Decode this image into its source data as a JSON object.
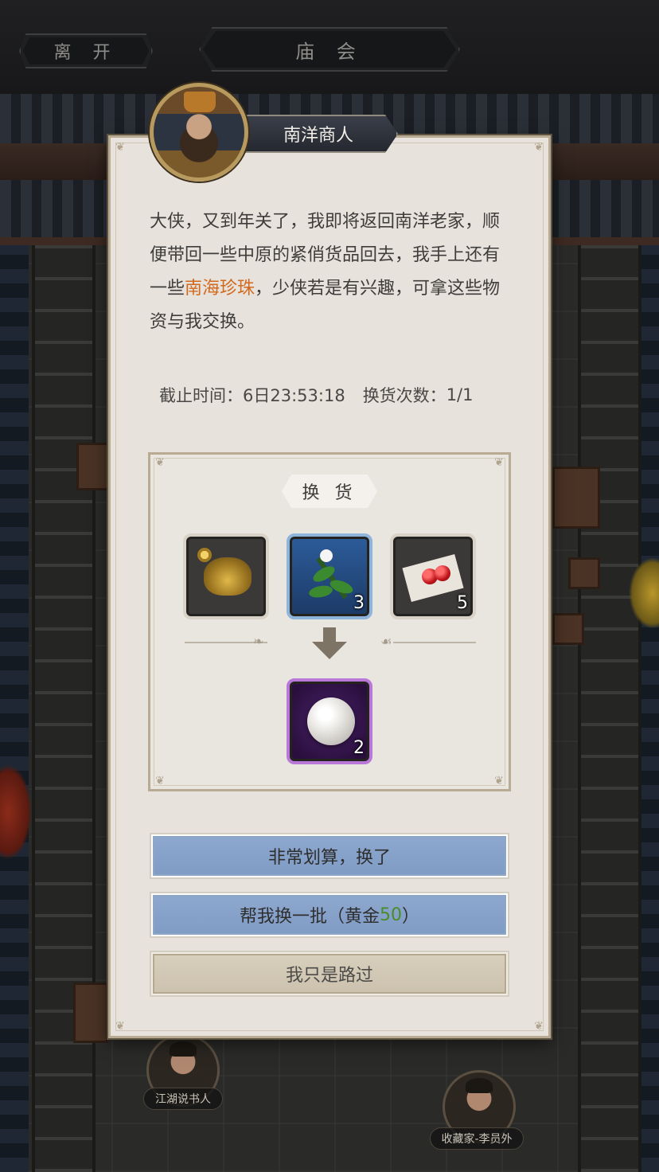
{
  "nav": {
    "leave_label": "离 开",
    "title": "庙 会"
  },
  "npcs": [
    {
      "name": "江湖说书人"
    },
    {
      "name": "收藏家-李员外"
    }
  ],
  "merchant": {
    "name": "南洋商人",
    "dialog_part1": "大侠，又到年关了，我即将返回南洋老家，顺便带回一些中原的紧俏货品回去，我手上还有一些",
    "dialog_highlight": "南海珍珠",
    "dialog_part2": "，少侠若是有兴趣，可拿这些物资与我交换。"
  },
  "info": {
    "deadline_label": "截止时间：",
    "deadline_value": "6日23:53:18",
    "count_label": "换货次数：",
    "count_value": "1/1"
  },
  "trade": {
    "title": "换 货",
    "inputs": [
      {
        "icon": "golden-toad-icon",
        "count": ""
      },
      {
        "icon": "herb-icon",
        "count": "3"
      },
      {
        "icon": "berries-icon",
        "count": "5"
      }
    ],
    "output": {
      "icon": "pearl-icon",
      "count": "2"
    }
  },
  "buttons": {
    "exchange_label": "非常划算，换了",
    "refresh_prefix": "帮我换一批（黄金",
    "refresh_cost": "50",
    "refresh_suffix": "）",
    "pass_label": "我只是路过"
  },
  "colors": {
    "highlight": "#d2691e",
    "gold_cost": "#4a8d2a",
    "button_blue": "#8ea8cf",
    "button_beige": "#d8cfbd",
    "panel_bg": "#e7e2db"
  }
}
